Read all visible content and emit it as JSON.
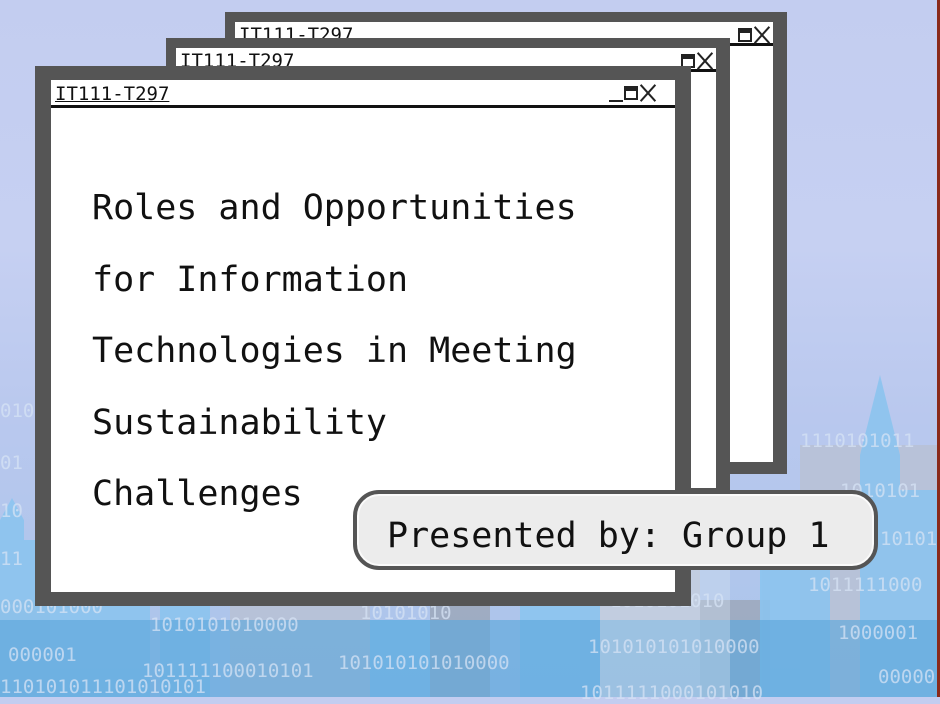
{
  "windows": [
    {
      "title": "IT111-T297",
      "controls": [
        "minimize-icon",
        "maximize-icon",
        "close-icon"
      ]
    },
    {
      "title": "IT111-T297",
      "controls": [
        "minimize-icon",
        "maximize-icon",
        "close-icon"
      ]
    },
    {
      "title": "IT111-T297",
      "controls": [
        "minimize-icon",
        "maximize-icon",
        "close-icon"
      ]
    }
  ],
  "slide": {
    "lines": [
      "Roles and Opportunities",
      "for Information",
      "Technologies in Meeting",
      "Sustainability",
      "Challenges"
    ]
  },
  "presenter": {
    "label": "Presented by: Group 1"
  },
  "background": {
    "binary": [
      "010",
      "01",
      "10",
      "11",
      "000101000",
      "000001",
      "110101011101010101",
      "1110101011",
      "1010101",
      "101011",
      "1011111000",
      "1000001",
      "00000",
      "1010101010000",
      "10101010",
      "101111100010101",
      "101010101010000",
      "101010101010000",
      "1010101010",
      "1011111000101010",
      "1110101011101010101"
    ]
  },
  "colors": {
    "frame": "#555555",
    "content_bg": "#ffffff",
    "sky": "#c3cdf0"
  }
}
